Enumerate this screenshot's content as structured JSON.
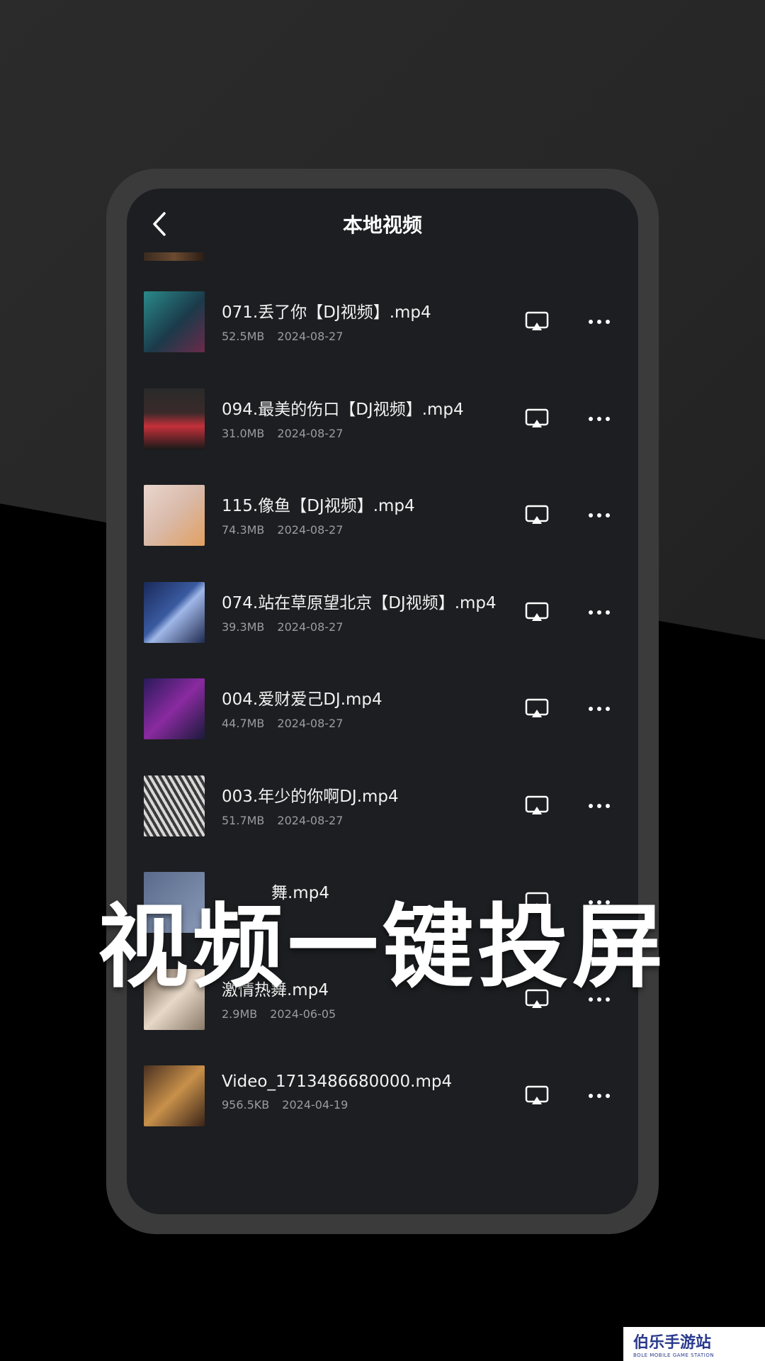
{
  "header": {
    "title": "本地视频"
  },
  "overlay": {
    "headline": "视频一键投屏"
  },
  "watermark": {
    "name": "伯乐手游站",
    "sub": "BOLE MOBILE GAME STATION"
  },
  "videos": [
    {
      "name": "071.丢了你【DJ视频】.mp4",
      "size": "52.5MB",
      "date": "2024-08-27"
    },
    {
      "name": "094.最美的伤口【DJ视频】.mp4",
      "size": "31.0MB",
      "date": "2024-08-27"
    },
    {
      "name": "115.像鱼【DJ视频】.mp4",
      "size": "74.3MB",
      "date": "2024-08-27"
    },
    {
      "name": "074.站在草原望北京【DJ视频】.mp4",
      "size": "39.3MB",
      "date": "2024-08-27"
    },
    {
      "name": "004.爱财爱己DJ.mp4",
      "size": "44.7MB",
      "date": "2024-08-27"
    },
    {
      "name": "003.年少的你啊DJ.mp4",
      "size": "51.7MB",
      "date": "2024-08-27"
    },
    {
      "name": "舞.mp4",
      "size": "",
      "date": ""
    },
    {
      "name": "激情热舞.mp4",
      "size": "2.9MB",
      "date": "2024-06-05"
    },
    {
      "name": "Video_1713486680000.mp4",
      "size": "956.5KB",
      "date": "2024-04-19"
    }
  ],
  "colors": {
    "accent_text": "#ffffff",
    "row_bg": "#1c1e21",
    "meta_text": "#9a9c9f"
  },
  "icons": {
    "back": "chevron-left-icon",
    "cast": "screen-cast-icon",
    "more": "more-dots-icon"
  }
}
